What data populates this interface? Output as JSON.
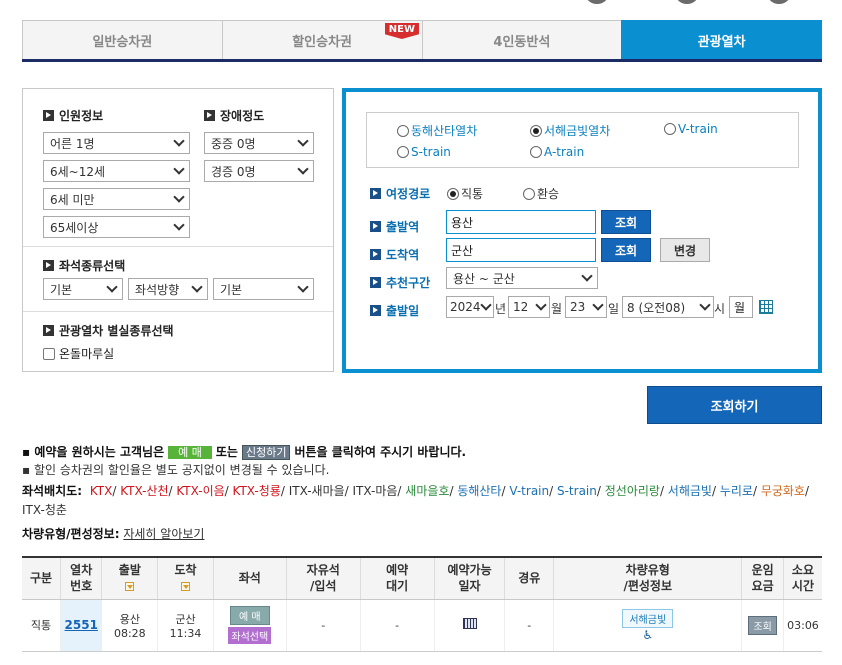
{
  "tabs": [
    {
      "label": "일반승차권",
      "active": false
    },
    {
      "label": "할인승차권",
      "active": false,
      "badge": "NEW"
    },
    {
      "label": "4인동반석",
      "active": false
    },
    {
      "label": "관광열차",
      "active": true
    }
  ],
  "left": {
    "passenger_title": "인원정보",
    "disability_title": "장애정도",
    "passengers": [
      "어른 1명",
      "6세~12세",
      "6세 미만",
      "65세이상"
    ],
    "disability": [
      "중증 0명",
      "경증 0명"
    ],
    "seat_title": "좌석종류선택",
    "seat_selects": [
      "기본",
      "좌석방향",
      "기본"
    ],
    "extra_title": "관광열차 별실종류선택",
    "extra_checkbox": "온돌마루실"
  },
  "right": {
    "trains": [
      {
        "label": "동해산타열차",
        "checked": false
      },
      {
        "label": "서해금빛열차",
        "checked": true
      },
      {
        "label": "V-train",
        "checked": false
      },
      {
        "label": "S-train",
        "checked": false
      },
      {
        "label": "A-train",
        "checked": false
      }
    ],
    "route_label": "여정경로",
    "route_direct": "직통",
    "route_transfer": "환승",
    "dep_label": "출발역",
    "dep_value": "용산",
    "arr_label": "도착역",
    "arr_value": "군산",
    "lookup_btn": "조회",
    "change_btn": "변경",
    "rec_label": "추천구간",
    "rec_value": "용산 ~ 군산",
    "date_label": "출발일",
    "year": "2024",
    "year_unit": "년",
    "month": "12",
    "month_unit": "월",
    "day": "23",
    "day_unit": "일",
    "hour": "8 (오전08)",
    "hour_unit": "시",
    "weekday": "월"
  },
  "search_btn": "조회하기",
  "notes": {
    "line1_pre": "예약을 원하시는 고객님은",
    "tag_reserve": "예 매",
    "line1_mid": "또는",
    "tag_apply": "신청하기",
    "line1_post": "버튼을 클릭하여 주시기 바랍니다.",
    "line2": "할인 승차권의 할인율은 별도 공지없이 변경될 수 있습니다."
  },
  "seat_layout": {
    "label": "좌석배치도:",
    "items": [
      {
        "name": "KTX",
        "color": "r"
      },
      {
        "name": "KTX-산천",
        "color": "r"
      },
      {
        "name": "KTX-이음",
        "color": "r"
      },
      {
        "name": "KTX-청룡",
        "color": "r"
      },
      {
        "name": "ITX-새마을",
        "color": "k"
      },
      {
        "name": "ITX-마음",
        "color": "k"
      },
      {
        "name": "새마을호",
        "color": "g"
      },
      {
        "name": "동해산타",
        "color": "b"
      },
      {
        "name": "V-train",
        "color": "b"
      },
      {
        "name": "S-train",
        "color": "b"
      },
      {
        "name": "정선아리랑",
        "color": "g"
      },
      {
        "name": "서해금빛",
        "color": "b"
      },
      {
        "name": "누리로",
        "color": "b"
      },
      {
        "name": "무궁화호",
        "color": "o"
      },
      {
        "name": "ITX-청춘",
        "color": "k"
      }
    ]
  },
  "vehicle_info": {
    "label": "차량유형/편성정보:",
    "link": "자세히 알아보기"
  },
  "table": {
    "headers": [
      "구분",
      "열차\n번호",
      "출발",
      "도착",
      "좌석",
      "자유석\n/입석",
      "예약\n대기",
      "예약가능\n일자",
      "경유",
      "차량유형\n/편성정보",
      "운임\n요금",
      "소요\n시간"
    ],
    "row": {
      "type": "직통",
      "train_no": "2551",
      "dep_station": "용산",
      "dep_time": "08:28",
      "arr_station": "군산",
      "arr_time": "11:34",
      "seat_btn": "예 매",
      "seat_select_btn": "좌석선택",
      "free_seat": "-",
      "waiting": "-",
      "via": "-",
      "vehicle": "서해금빛",
      "fare_btn": "조회",
      "duration": "03:06"
    }
  }
}
